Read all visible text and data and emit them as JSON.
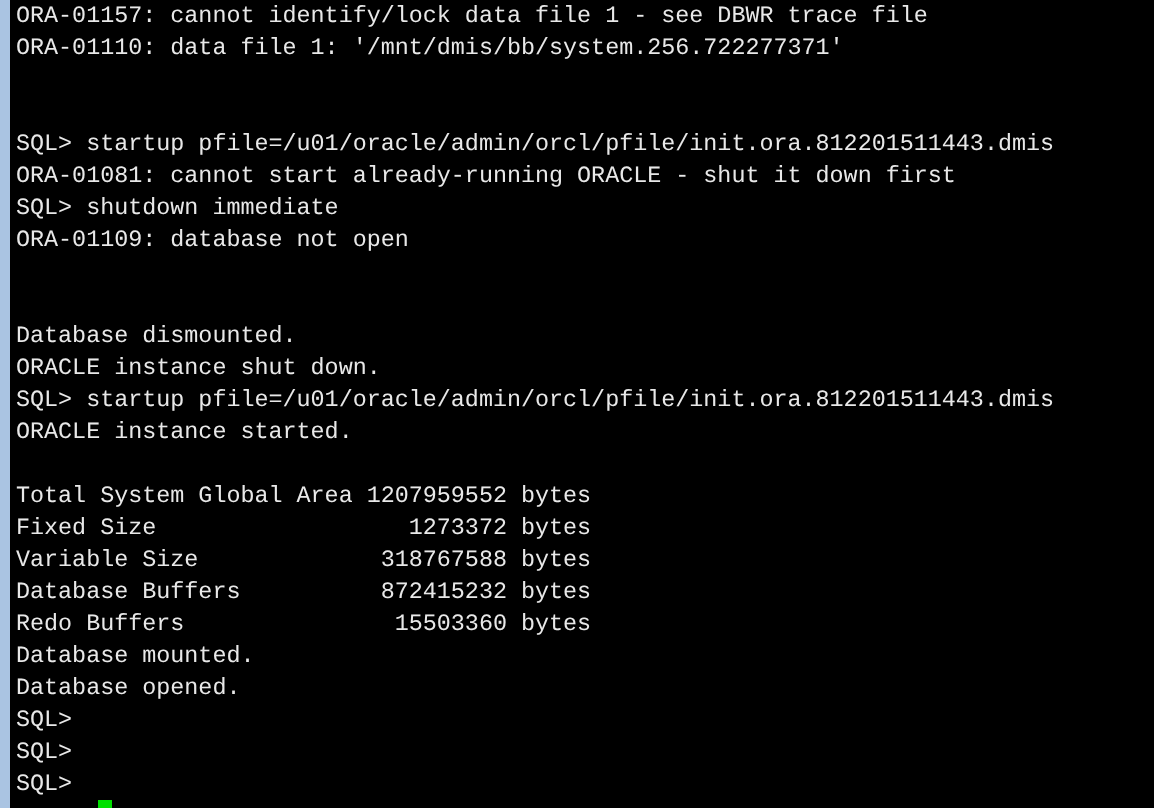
{
  "terminal": {
    "lines": [
      {
        "kind": "text",
        "text": "ORA-01157: cannot identify/lock data file 1 - see DBWR trace file"
      },
      {
        "kind": "text",
        "text": "ORA-01110: data file 1: '/mnt/dmis/bb/system.256.722277371'"
      },
      {
        "kind": "blank"
      },
      {
        "kind": "blank"
      },
      {
        "kind": "text",
        "text": "SQL> startup pfile=/u01/oracle/admin/orcl/pfile/init.ora.812201511443.dmis"
      },
      {
        "kind": "text",
        "text": "ORA-01081: cannot start already-running ORACLE - shut it down first"
      },
      {
        "kind": "text",
        "text": "SQL> shutdown immediate"
      },
      {
        "kind": "text",
        "text": "ORA-01109: database not open"
      },
      {
        "kind": "blank"
      },
      {
        "kind": "blank"
      },
      {
        "kind": "text",
        "text": "Database dismounted."
      },
      {
        "kind": "text",
        "text": "ORACLE instance shut down."
      },
      {
        "kind": "text",
        "text": "SQL> startup pfile=/u01/oracle/admin/orcl/pfile/init.ora.812201511443.dmis"
      },
      {
        "kind": "text",
        "text": "ORACLE instance started."
      },
      {
        "kind": "blank"
      },
      {
        "kind": "text",
        "text": "Total System Global Area 1207959552 bytes"
      },
      {
        "kind": "text",
        "text": "Fixed Size                  1273372 bytes"
      },
      {
        "kind": "text",
        "text": "Variable Size             318767588 bytes"
      },
      {
        "kind": "text",
        "text": "Database Buffers          872415232 bytes"
      },
      {
        "kind": "text",
        "text": "Redo Buffers               15503360 bytes"
      },
      {
        "kind": "text",
        "text": "Database mounted."
      },
      {
        "kind": "text",
        "text": "Database opened."
      },
      {
        "kind": "text",
        "text": "SQL>"
      },
      {
        "kind": "text",
        "text": "SQL>"
      },
      {
        "kind": "text",
        "text": "SQL>"
      },
      {
        "kind": "cursor"
      }
    ]
  }
}
